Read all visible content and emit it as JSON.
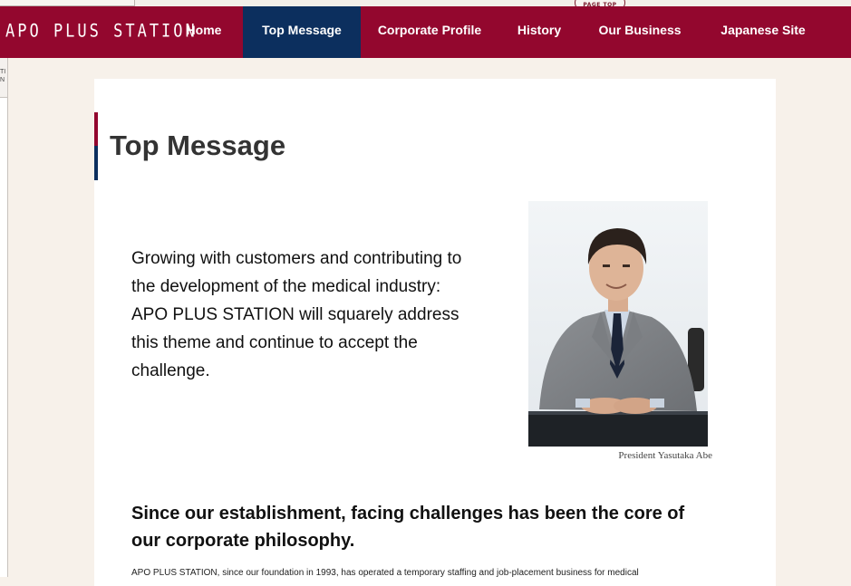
{
  "page_top": {
    "label": "PAGE TOP"
  },
  "nav": {
    "logo": "APO PLUS STATION",
    "items": [
      {
        "label": "Home"
      },
      {
        "label": "Top Message"
      },
      {
        "label": "Corporate Profile"
      },
      {
        "label": "History"
      },
      {
        "label": "Our Business"
      },
      {
        "label": "Japanese Site"
      }
    ]
  },
  "side_fragment": {
    "text": "TI\nN"
  },
  "content": {
    "title": "Top Message",
    "lead": "Growing with customers and contributing to the development of the medical industry: APO PLUS STATION will squarely address this theme and continue to accept the challenge.",
    "photo_caption": "President Yasutaka Abe",
    "subhead": "Since our establishment, facing challenges has been the core of our corporate philosophy.",
    "body": "APO PLUS STATION, since our foundation in 1993, has operated a temporary staffing and job-placement business for medical"
  },
  "colors": {
    "brand_red": "#93072e",
    "brand_navy": "#0c2f5e",
    "page_bg": "#f7f1ea"
  }
}
